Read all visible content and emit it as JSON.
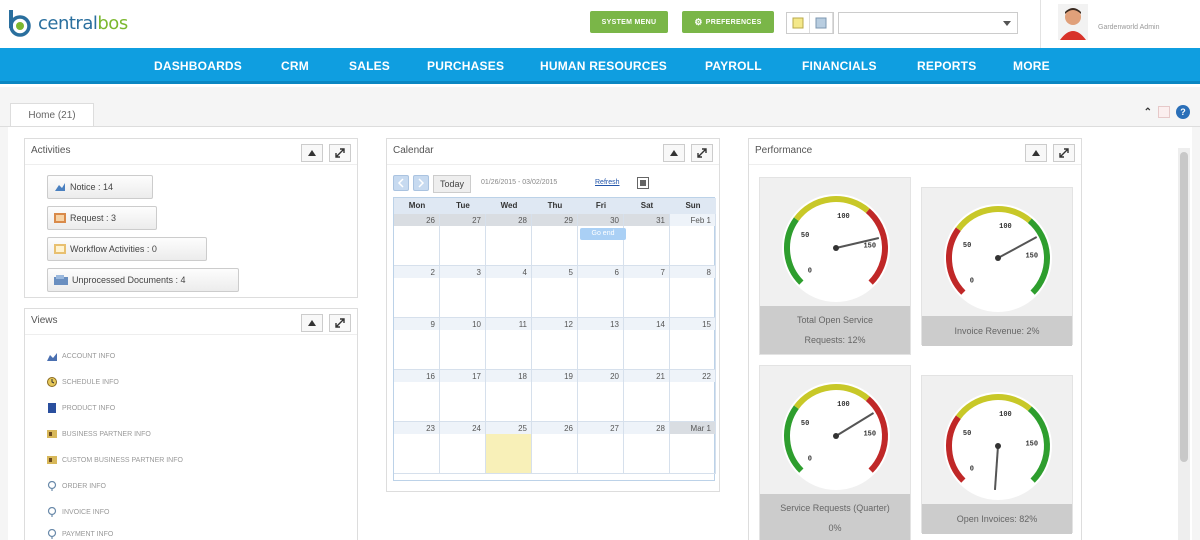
{
  "brand": {
    "name_part1": "central",
    "name_part2": "bos",
    "color_blue": "#2a6f9e",
    "color_green": "#7cb82f"
  },
  "header": {
    "system_menu_label": "SYSTEM MENU",
    "preferences_label": "PREFERENCES",
    "user_name": "Gardenworld Admin"
  },
  "nav": {
    "items": [
      "DASHBOARDS",
      "CRM",
      "SALES",
      "PURCHASES",
      "HUMAN RESOURCES",
      "PAYROLL",
      "FINANCIALS",
      "REPORTS",
      "MORE"
    ],
    "color": "#0f9ee0"
  },
  "tabs": {
    "home_label": "Home (21)"
  },
  "activities": {
    "title": "Activities",
    "items": [
      {
        "label": "Notice : 14",
        "icon": "notice-icon"
      },
      {
        "label": "Request : 3",
        "icon": "request-icon"
      },
      {
        "label": "Workflow Activities : 0",
        "icon": "workflow-icon"
      },
      {
        "label": "Unprocessed Documents : 4",
        "icon": "documents-icon"
      }
    ]
  },
  "views": {
    "title": "Views",
    "items": [
      {
        "label": "ACCOUNT INFO",
        "icon": "account-icon"
      },
      {
        "label": "SCHEDULE INFO",
        "icon": "schedule-icon"
      },
      {
        "label": "PRODUCT INFO",
        "icon": "product-icon"
      },
      {
        "label": "BUSINESS PARTNER INFO",
        "icon": "business-partner-icon"
      },
      {
        "label": "CUSTOM BUSINESS PARTNER INFO",
        "icon": "custom-business-partner-icon"
      },
      {
        "label": "ORDER INFO",
        "icon": "order-icon"
      },
      {
        "label": "INVOICE INFO",
        "icon": "invoice-icon"
      },
      {
        "label": "PAYMENT INFO",
        "icon": "payment-icon"
      }
    ]
  },
  "calendar": {
    "title": "Calendar",
    "today_label": "Today",
    "range": "01/26/2015 - 03/02/2015",
    "refresh_label": "Refresh",
    "days": [
      "Mon",
      "Tue",
      "Wed",
      "Thu",
      "Fri",
      "Sat",
      "Sun"
    ],
    "weeks": [
      [
        "26",
        "27",
        "28",
        "29",
        "30",
        "31",
        "Feb 1"
      ],
      [
        "2",
        "3",
        "4",
        "5",
        "6",
        "7",
        "8"
      ],
      [
        "9",
        "10",
        "11",
        "12",
        "13",
        "14",
        "15"
      ],
      [
        "16",
        "17",
        "18",
        "19",
        "20",
        "21",
        "22"
      ],
      [
        "23",
        "24",
        "25",
        "26",
        "27",
        "28",
        "Mar 1"
      ]
    ],
    "event_label": "Go end",
    "highlight_color": "#f8f0b8"
  },
  "performance": {
    "title": "Performance",
    "gauges": [
      {
        "label_line1": "Total Open Service",
        "label_line2": "Requests: 12%",
        "value": 12,
        "scheme": "green-to-red",
        "ticks": [
          "0",
          "50",
          "100",
          "150"
        ]
      },
      {
        "label_line1": "Invoice Revenue: 2%",
        "label_line2": "",
        "value": 2,
        "scheme": "red-to-green",
        "ticks": [
          "0",
          "50",
          "100",
          "150"
        ]
      },
      {
        "label_line1": "Service Requests (Quarter)",
        "label_line2": "0%",
        "value": 0,
        "scheme": "green-to-red",
        "ticks": [
          "0",
          "50",
          "100",
          "150"
        ]
      },
      {
        "label_line1": "Open Invoices: 82%",
        "label_line2": "",
        "value": 82,
        "scheme": "red-to-green",
        "ticks": [
          "0",
          "50",
          "100",
          "150"
        ]
      }
    ]
  }
}
